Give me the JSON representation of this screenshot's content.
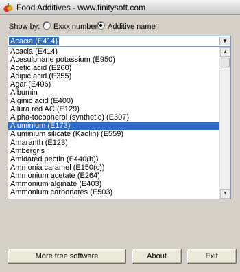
{
  "window": {
    "title": "Food Additives - www.finitysoft.com",
    "icon": "food-additives-app-icon"
  },
  "show_by": {
    "label": "Show by:",
    "options": [
      {
        "label": "Exxx number",
        "checked": false
      },
      {
        "label": "Additive name",
        "checked": true
      }
    ]
  },
  "combo": {
    "selected_value": "Acacia (E414)"
  },
  "list": {
    "items": [
      "Acacia (E414)",
      "Acesulphane potassium (E950)",
      "Acetic acid (E260)",
      "Adipic acid (E355)",
      "Agar (E406)",
      "Albumin",
      "Alginic acid (E400)",
      "Allura red AC (E129)",
      "Alpha-tocopherol (synthetic) (E307)",
      "Aluminium (E173)",
      "Aluminium silicate (Kaolin) (E559)",
      "Amaranth (E123)",
      "Ambergris",
      "Amidated pectin (E440(b))",
      "Ammonia caramel (E150(c))",
      "Ammonium acetate (E264)",
      "Ammonium alginate (E403)",
      "Ammonium carbonates (E503)"
    ],
    "selected_index": 9
  },
  "buttons": {
    "more": "More free software",
    "about": "About",
    "exit": "Exit"
  },
  "colors": {
    "selection": "#316ac5",
    "window_bg": "#d4d0c8"
  }
}
